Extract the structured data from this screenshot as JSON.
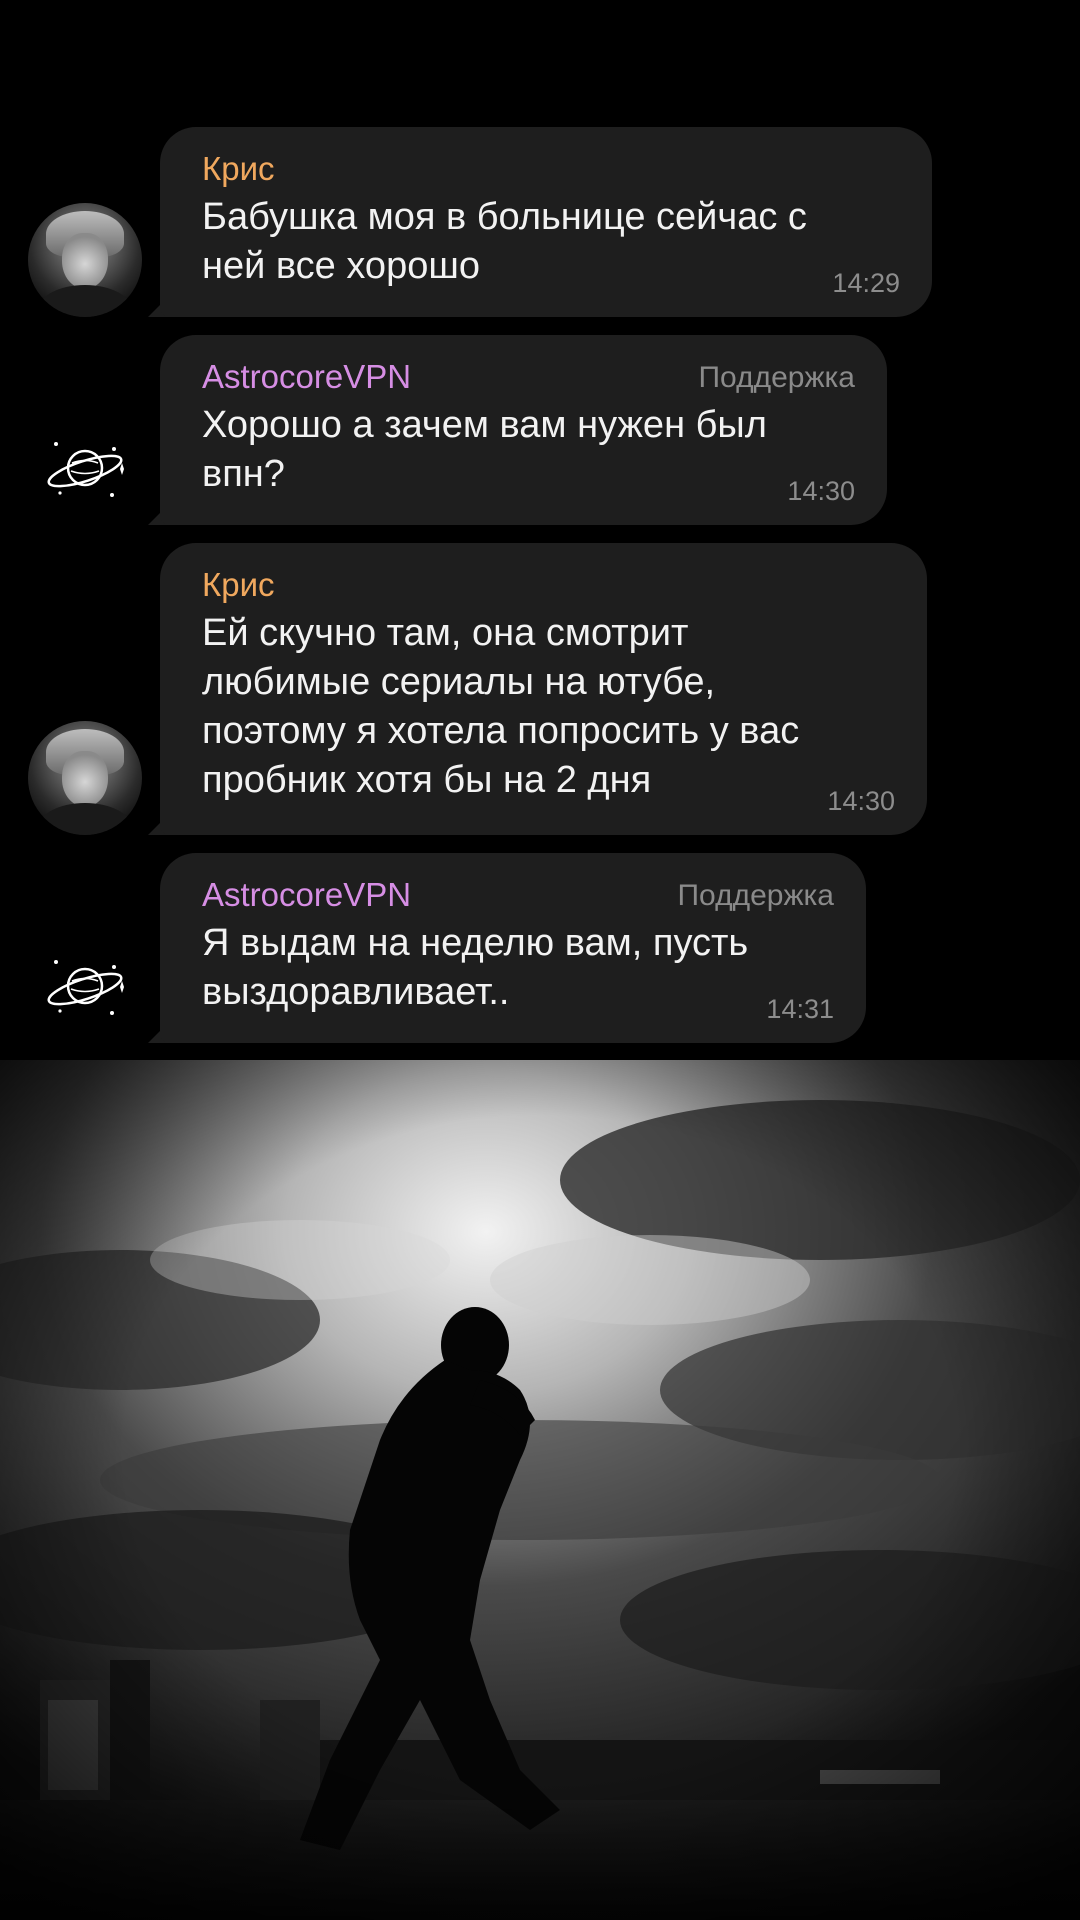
{
  "messages": [
    {
      "sender": "Крис",
      "role": "",
      "text": "Бабушка моя в больнице сейчас с\nней все хорошо",
      "time": "14:29"
    },
    {
      "sender": "AstrocoreVPN",
      "role": "Поддержка",
      "text": "Хорошо а зачем вам нужен был\nвпн?",
      "time": "14:30"
    },
    {
      "sender": "Крис",
      "role": "",
      "text": "Ей скучно там, она смотрит\nлюбимые сериалы на ютубе,\nпоэтому я хотела попросить у вас\nпробник хотя бы на 2 дня",
      "time": "14:30"
    },
    {
      "sender": "AstrocoreVPN",
      "role": "Поддержка",
      "text": "Я выдам на неделю вам, пусть\nвыздоравливает..",
      "time": "14:31"
    }
  ],
  "icons": {
    "user_avatar": "anime-avatar",
    "support_avatar": "saturn-planet-icon"
  },
  "colors": {
    "kris_name": "#f0a85e",
    "vpn_name": "#d68ee4",
    "bubble": "#1e1e1e",
    "background": "#000000"
  }
}
